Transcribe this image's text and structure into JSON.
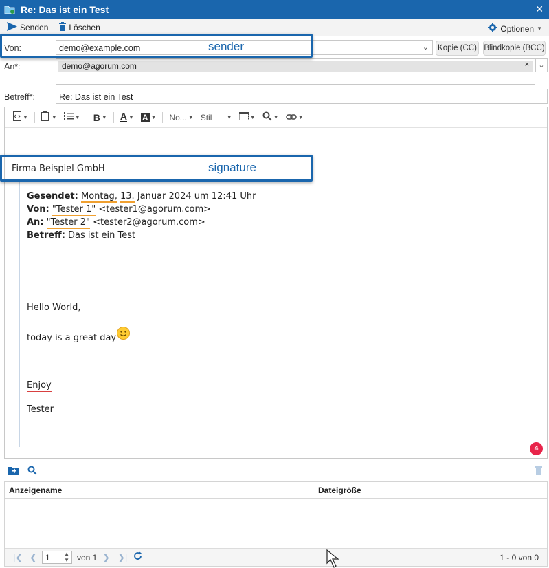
{
  "window": {
    "title": "Re: Das ist ein Test"
  },
  "toolbar": {
    "send_label": "Senden",
    "delete_label": "Löschen",
    "options_label": "Optionen"
  },
  "form": {
    "from_label": "Von:",
    "from_value": "demo@example.com",
    "cc_label": "Kopie (CC)",
    "bcc_label": "Blindkopie (BCC)",
    "to_label": "An*:",
    "to_recipient": "demo@agorum.com",
    "subject_label": "Betreff*:",
    "subject_value": "Re: Das ist ein Test"
  },
  "annotations": {
    "sender": "sender",
    "signature": "signature"
  },
  "editor_toolbar": {
    "font_size": "No...",
    "style": "Stil"
  },
  "body": {
    "signature": "Firma Beispiel GmbH",
    "sent_label": "Gesendet:",
    "sent_day": "Montag,",
    "sent_date": "13.",
    "sent_rest": "Januar 2024 um 12:41 Uhr",
    "from_label": "Von:",
    "from_name": "\"Tester 1\"",
    "from_email": "<tester1@agorum.com>",
    "to_label": "An:",
    "to_name": "\"Tester 2\"",
    "to_email": "<tester2@agorum.com>",
    "subject_label": "Betreff:",
    "subject_value": "Das ist ein Test",
    "greeting": "Hello World,",
    "line2": "today is a great day",
    "enjoy": "Enjoy",
    "closing": "Tester"
  },
  "badge": {
    "count": "4"
  },
  "attachments": {
    "columns": [
      "Anzeigename",
      "Dateigröße"
    ],
    "pager": {
      "page": "1",
      "of_label": "von 1",
      "summary": "1 - 0 von 0"
    }
  },
  "colors": {
    "accent": "#1a66ad",
    "badge": "#e8244a",
    "spell_orange": "#f0a030",
    "spell_red": "#d84040"
  }
}
